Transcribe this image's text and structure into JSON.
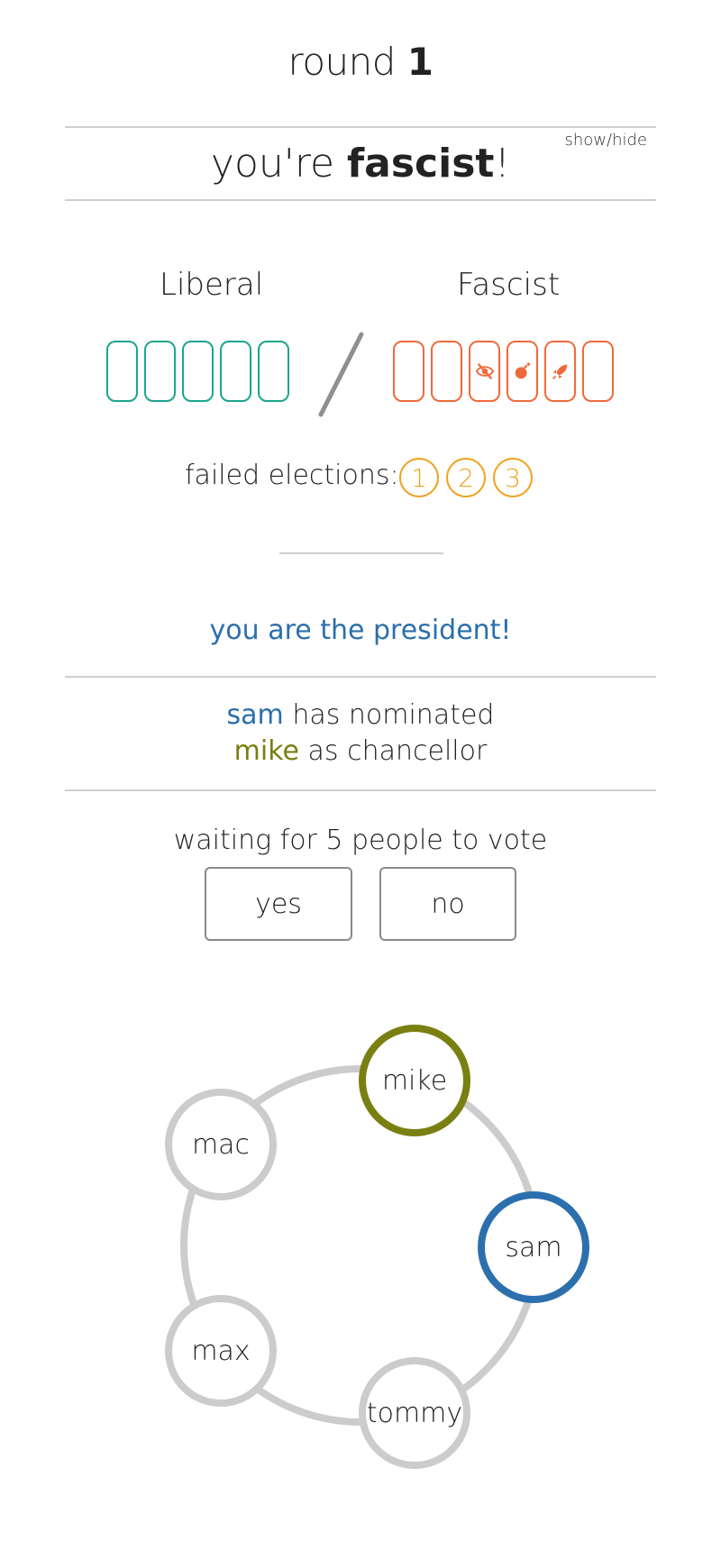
{
  "round": {
    "word": "round",
    "number": "1"
  },
  "role": {
    "prefix": "you're ",
    "name": "fascist",
    "suffix": "!",
    "toggle": "show/hide"
  },
  "tracks": {
    "liberal": {
      "label": "Liberal",
      "slots": 5,
      "color": "#1aa58e"
    },
    "fascist": {
      "label": "Fascist",
      "slots": 6,
      "color": "#ef6a3b",
      "powers": [
        "",
        "",
        "eye-slash-icon",
        "bomb-icon",
        "rocket-icon",
        ""
      ]
    }
  },
  "failed_elections": {
    "label": "failed elections:",
    "markers": [
      "1",
      "2",
      "3"
    ],
    "color": "#f0a11c"
  },
  "status": {
    "president_msg": "you are the president!",
    "nomination": {
      "president": "sam",
      "has_nominated": " has nominated",
      "chancellor": "mike",
      "as_chancellor": " as chancellor"
    }
  },
  "vote": {
    "waiting": "waiting for 5 people to vote",
    "yes": "yes",
    "no": "no"
  },
  "players": [
    {
      "name": "mike",
      "role": "chancellor-nominee",
      "color": "#7a7f12"
    },
    {
      "name": "sam",
      "role": "president",
      "color": "#2c6fad"
    },
    {
      "name": "tommy",
      "role": "",
      "color": "#cccccc"
    },
    {
      "name": "max",
      "role": "",
      "color": "#cccccc"
    },
    {
      "name": "mac",
      "role": "",
      "color": "#cccccc"
    }
  ]
}
